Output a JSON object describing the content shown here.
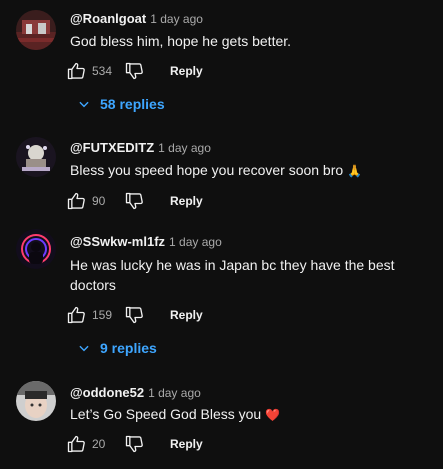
{
  "comments": [
    {
      "author": "@Roanlgoat",
      "time": "1 day ago",
      "text": "God bless him, hope he gets better.",
      "likes": "534",
      "reply_label": "Reply",
      "replies_label": "58 replies"
    },
    {
      "author": "@FUTXEDITZ",
      "time": "1 day ago",
      "text": "Bless you speed hope you recover soon bro",
      "emoji": "🙏",
      "likes": "90",
      "reply_label": "Reply"
    },
    {
      "author": "@SSwkw-ml1fz",
      "time": "1 day ago",
      "text": "He was lucky he was in Japan bc they have the best doctors",
      "likes": "159",
      "reply_label": "Reply",
      "replies_label": "9 replies"
    },
    {
      "author": "@oddone52",
      "time": "1 day ago",
      "text": "Let’s Go Speed God Bless you",
      "emoji": "❤️",
      "likes": "20",
      "reply_label": "Reply"
    }
  ],
  "colors": {
    "background": "#0f0f0f",
    "text": "#f1f1f1",
    "secondary_text": "#aaaaaa",
    "link_blue": "#3ea6ff",
    "heart_red": "#e53935"
  },
  "icons": [
    "thumbs-up-icon",
    "thumbs-down-icon",
    "chevron-down-icon",
    "avatar"
  ]
}
